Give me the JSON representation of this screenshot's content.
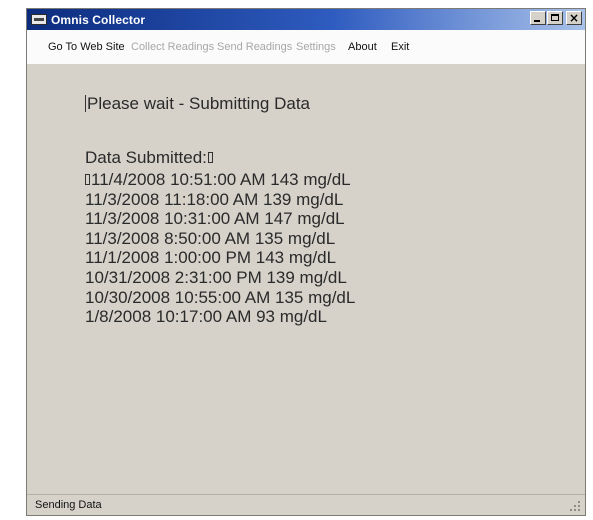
{
  "window": {
    "title": "Omnis Collector",
    "title_icon": "app-icon",
    "controls": {
      "minimize_icon": "minimize-icon",
      "maximize_icon": "maximize-icon",
      "close_glyph": "×"
    }
  },
  "menu": {
    "items": [
      {
        "label": "Go To Web Site",
        "enabled": true
      },
      {
        "label": "Collect Readings",
        "enabled": false
      },
      {
        "label": "Send Readings",
        "enabled": false
      },
      {
        "label": "Settings",
        "enabled": false
      },
      {
        "label": "About",
        "enabled": true
      },
      {
        "label": "Exit",
        "enabled": true
      }
    ]
  },
  "main": {
    "status_message": "Please wait - Submitting Data",
    "submitted_label": "Data Submitted:",
    "readings": [
      "11/4/2008 10:51:00 AM 143 mg/dL",
      "11/3/2008 11:18:00 AM 139 mg/dL",
      "11/3/2008 10:31:00 AM 147 mg/dL",
      "11/3/2008 8:50:00 AM 135 mg/dL",
      "11/1/2008 1:00:00 PM 143 mg/dL",
      "10/31/2008 2:31:00 PM 139 mg/dL",
      "10/30/2008 10:55:00 AM 135 mg/dL",
      "1/8/2008 10:17:00 AM 93 mg/dL"
    ]
  },
  "statusbar": {
    "text": "Sending Data",
    "grip_icon": "resize-grip-icon"
  },
  "colors": {
    "title_start": "#0c2c7e",
    "title_end": "#a9c2ea",
    "window_bg": "#d6d2ca",
    "menu_bg": "#fbfbfb",
    "menu_disabled": "#a7a7a7"
  }
}
